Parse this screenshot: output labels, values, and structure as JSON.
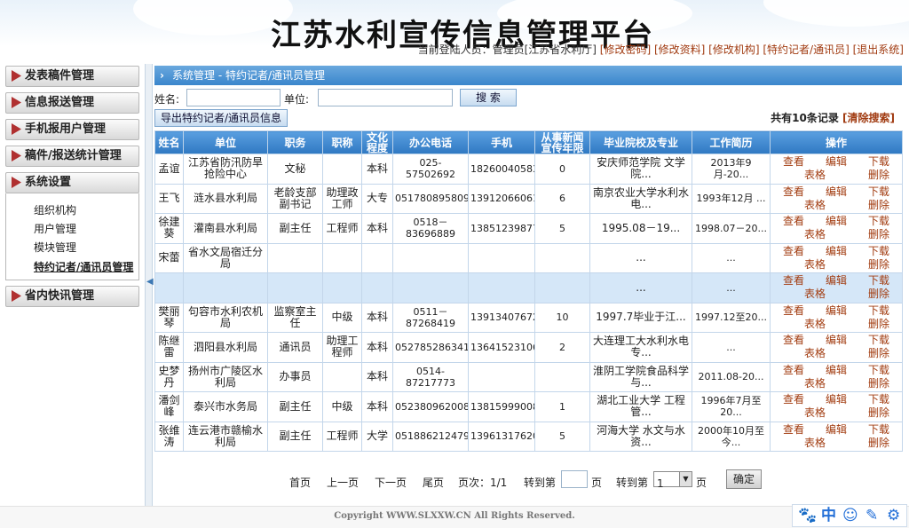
{
  "header": {
    "title": "江苏水利宣传信息管理平台",
    "user_label": "当前登陆人员：管理员[江苏省水利厅]",
    "links": [
      "[修改密码]",
      "[修改资料]",
      "[修改机构]",
      "[特约记者/通讯员]",
      "[退出系统]"
    ]
  },
  "sidebar": {
    "menus": [
      "发表稿件管理",
      "信息报送管理",
      "手机报用户管理",
      "稿件/报送统计管理",
      "系统设置",
      "省内快讯管理"
    ],
    "sub_items": [
      "组织机构",
      "用户管理",
      "模块管理",
      "特约记者/通讯员管理"
    ]
  },
  "main": {
    "breadcrumb": "系统管理 - 特约记者/通讯员管理",
    "search": {
      "name_label": "姓名:",
      "unit_label": "单位:",
      "name_value": "",
      "unit_value": "",
      "search_button": "搜 索"
    },
    "export_button": "导出特约记者/通讯员信息",
    "total_text": "共有10条记录",
    "clear_search": "[清除搜索]",
    "columns": [
      "姓名",
      "单位",
      "职务",
      "职称",
      "文化程度",
      "办公电话",
      "手机",
      "从事新闻宣传年限",
      "毕业院校及专业",
      "工作简历",
      "操作"
    ],
    "ops": [
      "查看",
      "编辑",
      "下载",
      "表格",
      "删除"
    ],
    "rows": [
      [
        "孟谊",
        "江苏省防汛防旱抢险中心",
        "文秘",
        "",
        "本科",
        "025-57502692",
        "18260040583",
        "0",
        "安庆师范学院 文学院...",
        "2013年9月-20..."
      ],
      [
        "王飞",
        "涟水县水利局",
        "老龄支部副书记",
        "助理政工师",
        "大专",
        "051780895809",
        "13912066061",
        "6",
        "南京农业大学水利水电...",
        "1993年12月 ..."
      ],
      [
        "徐建葵",
        "灌南县水利局",
        "副主任",
        "工程师",
        "本科",
        "0518－83696889",
        "13851239877",
        "5",
        "1995.08－19...",
        "1998.07－20..."
      ],
      [
        "宋蕾",
        "省水文局宿迁分局",
        "",
        "",
        "",
        "",
        "",
        "",
        "...",
        "..."
      ],
      [
        "",
        "",
        "",
        "",
        "",
        "",
        "",
        "",
        "...",
        "..."
      ],
      [
        "樊丽琴",
        "句容市水利农机局",
        "监察室主任",
        "中级",
        "本科",
        "0511－87268419",
        "13913407672",
        "10",
        "1997.7毕业于江...",
        "1997.12至20..."
      ],
      [
        "陈继雷",
        "泗阳县水利局",
        "通讯员",
        "助理工程师",
        "本科",
        "052785286341",
        "13641523106",
        "2",
        "大连理工大水利水电专...",
        "..."
      ],
      [
        "史梦丹",
        "扬州市广陵区水利局",
        "办事员",
        "",
        "本科",
        "0514-87217773",
        "",
        "",
        "淮阴工学院食品科学与...",
        "2011.08-20..."
      ],
      [
        "潘剑峰",
        "泰兴市水务局",
        "副主任",
        "中级",
        "本科",
        "052380962008",
        "13815999008",
        "1",
        "湖北工业大学 工程管...",
        "1996年7月至20..."
      ],
      [
        "张维涛",
        "连云港市赣榆水利局",
        "副主任",
        "工程师",
        "大学",
        "051886212479",
        "13961317620",
        "5",
        "河海大学 水文与水资...",
        "2000年10月至今..."
      ]
    ],
    "pager": {
      "first": "首页",
      "prev": "上一页",
      "next": "下一页",
      "last": "尾页",
      "page_info": "页次：1/1",
      "goto_label": "转到第",
      "page_unit": "页",
      "goto_label2": "转到第",
      "select_value": "1",
      "page_unit2": "页",
      "confirm": "确定"
    }
  },
  "footer": {
    "copyright": "Copyright WWW.SLXXW.CN All Rights Reserved."
  },
  "toolbox": [
    "paw-icon",
    "中",
    "smile-icon",
    "pen-icon",
    "gear-icon"
  ]
}
